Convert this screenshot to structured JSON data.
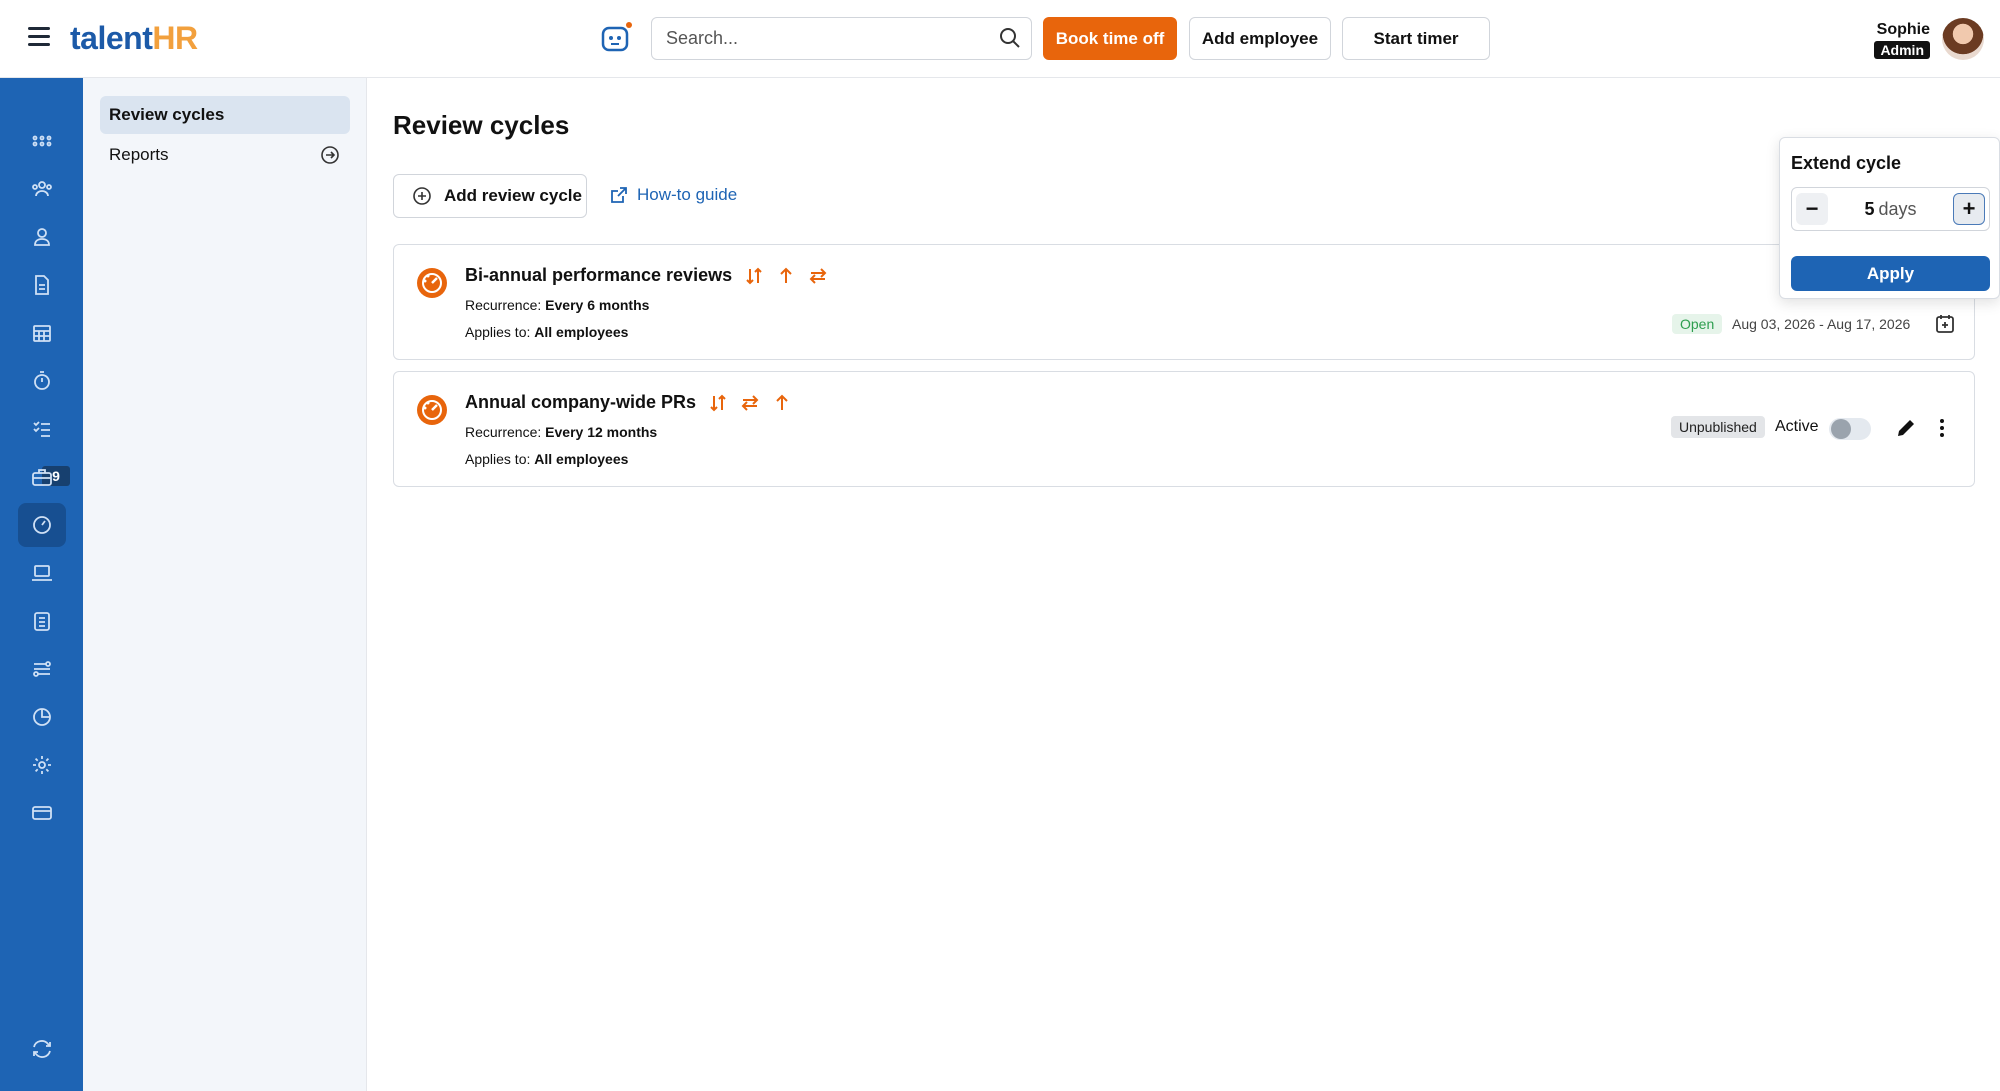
{
  "header": {
    "logo_left": "talent",
    "logo_right": "HR",
    "search_placeholder": "Search...",
    "book_time_off": "Book time off",
    "add_employee": "Add employee",
    "start_timer": "Start timer",
    "user_name": "Sophie",
    "user_role": "Admin"
  },
  "nav": {
    "badge_count": "9",
    "icons": [
      "apps-icon",
      "people-icon",
      "person-icon",
      "document-icon",
      "calendar-icon",
      "stopwatch-icon",
      "checklist-icon",
      "briefcase-icon",
      "performance-icon",
      "laptop-icon",
      "clipboard-icon",
      "workflow-icon",
      "reports-icon",
      "settings-icon",
      "billing-icon",
      "sync-icon"
    ]
  },
  "subnav": {
    "items": [
      {
        "label": "Review cycles"
      },
      {
        "label": "Reports"
      }
    ]
  },
  "main": {
    "title": "Review cycles",
    "add_cycle": "Add review cycle",
    "howto": "How-to guide",
    "cycles": [
      {
        "title": "Bi-annual performance reviews",
        "recurrence_label": "Recurrence:",
        "recurrence": "Every 6 months",
        "applies_label": "Applies to:",
        "applies": "All employees",
        "status": "Open",
        "dates": "Aug 03, 2026 - Aug 17, 2026"
      },
      {
        "title": "Annual company-wide PRs",
        "recurrence_label": "Recurrence:",
        "recurrence": "Every 12 months",
        "applies_label": "Applies to:",
        "applies": "All employees",
        "status": "Unpublished",
        "active_label": "Active"
      }
    ]
  },
  "popover": {
    "title": "Extend cycle",
    "value": "5",
    "unit": "days",
    "apply": "Apply"
  },
  "colors": {
    "accent_orange": "#e8650c",
    "nav_blue": "#1e64b4",
    "open_green": "#2e9e4f"
  }
}
